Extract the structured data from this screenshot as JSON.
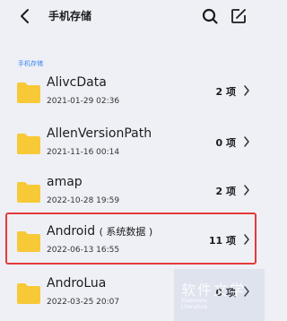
{
  "header": {
    "title": "手机存储",
    "icons": [
      "back-icon",
      "search-icon",
      "edit-icon"
    ]
  },
  "section": {
    "label": "手机存储"
  },
  "folders": [
    {
      "name": "AlivcData",
      "date": "2021-01-29 02:36",
      "count": "2 项"
    },
    {
      "name": "AllenVersionPath",
      "date": "2021-11-16 00:14",
      "count": "0 项"
    },
    {
      "name": "amap",
      "date": "2022-10-28 19:59",
      "count": "2 项"
    },
    {
      "name": "Android",
      "tag": "( 系统数据 )",
      "date": "2022-06-13 16:55",
      "count": "11 项"
    },
    {
      "name": "AndroLua",
      "date": "2022-03-25 20:07",
      "count": "0 项"
    }
  ],
  "watermark": {
    "title": "软件文学",
    "line1": "Elaborate",
    "line2": "Literature"
  },
  "colors": {
    "accent": "#3a84f0",
    "folder": "#f7c937",
    "highlight": "#e23a3a",
    "background": "#eef0f6"
  }
}
